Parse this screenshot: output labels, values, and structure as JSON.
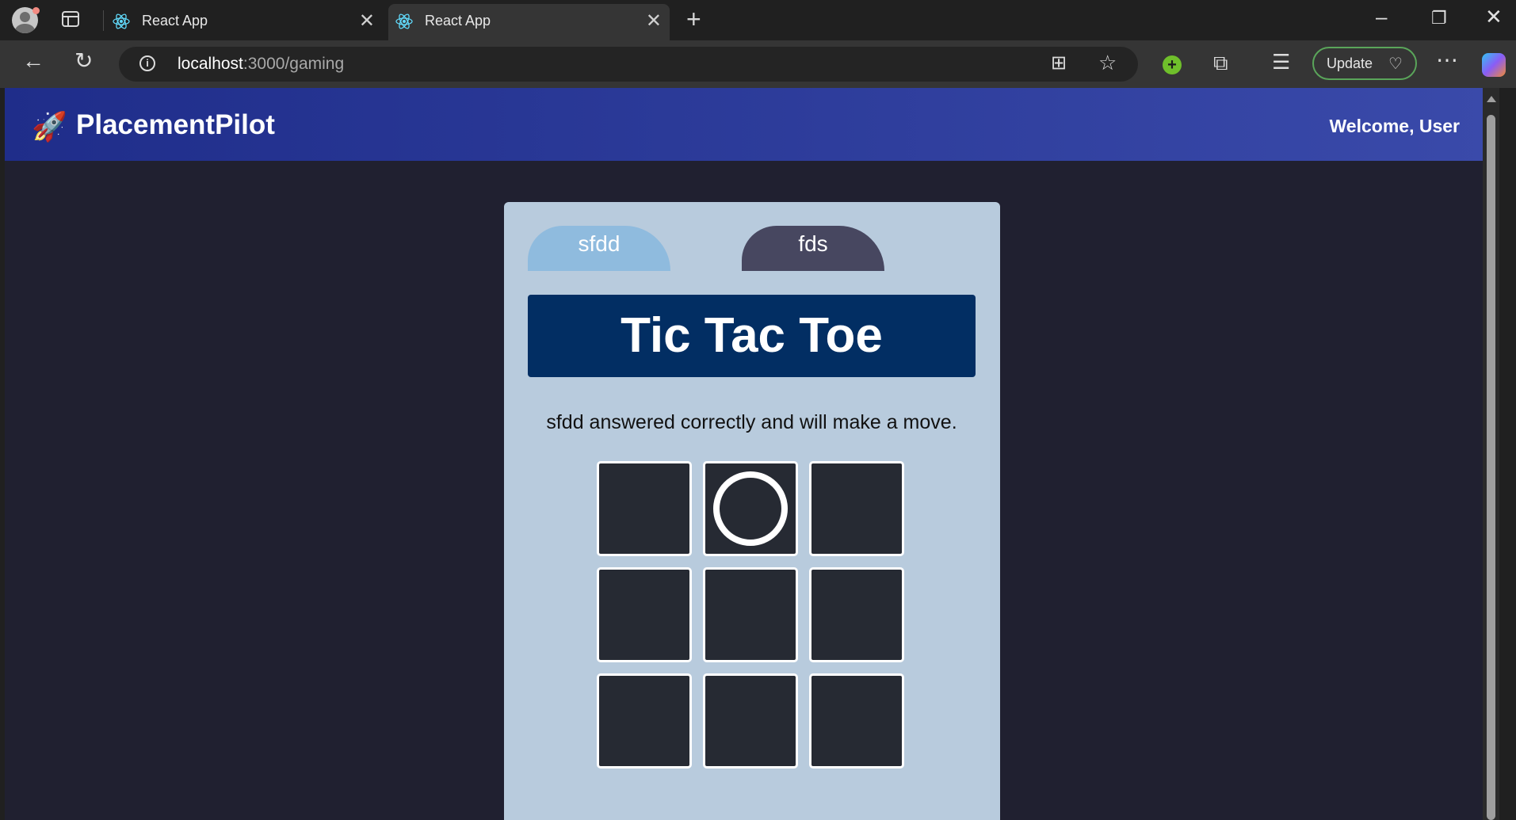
{
  "browser": {
    "tabs": [
      {
        "title": "React App"
      },
      {
        "title": "React App"
      }
    ],
    "url_host": "localhost",
    "url_path": ":3000/gaming",
    "update_label": "Update"
  },
  "app": {
    "brand": "PlacementPilot",
    "welcome": "Welcome, User"
  },
  "game": {
    "player1": "sfdd",
    "player2": "fds",
    "title": "Tic Tac Toe",
    "status": "sfdd answered correctly and will make a move.",
    "board": [
      "",
      "O",
      "",
      "",
      "",
      "",
      "",
      "",
      ""
    ]
  },
  "colors": {
    "header_start": "#1f2d8a",
    "header_end": "#3a4aaa",
    "card_bg": "#b8cbdd",
    "title_bg": "#022e63",
    "player1_tab": "#8fbbde",
    "player2_tab": "#474760",
    "cell_bg": "#262a33"
  }
}
